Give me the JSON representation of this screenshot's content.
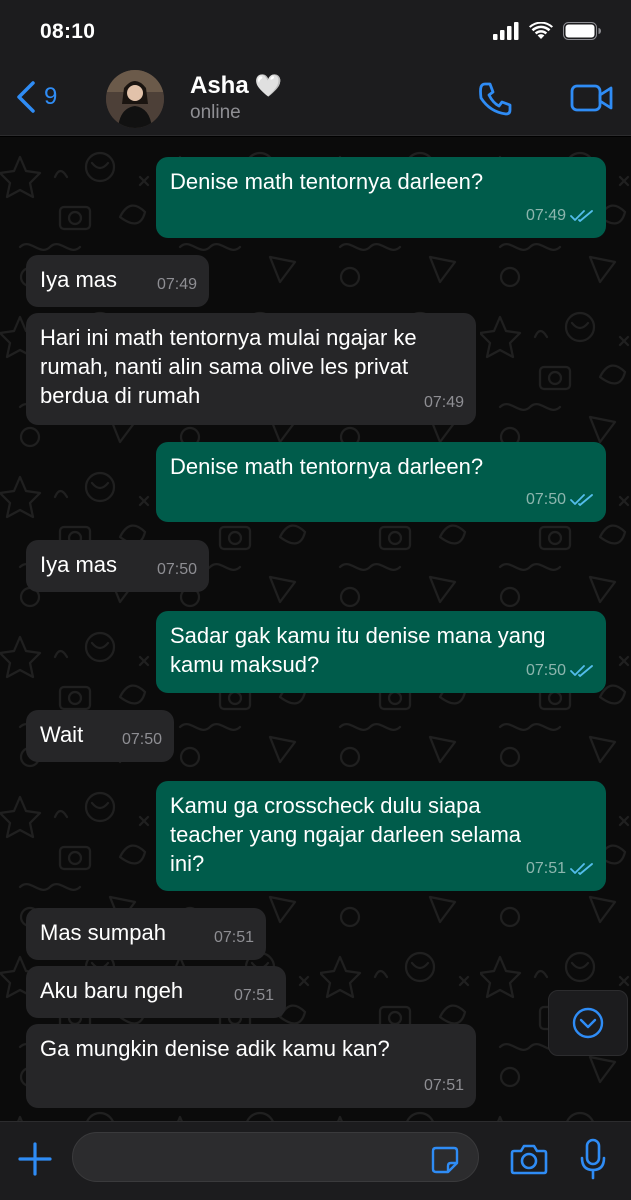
{
  "status_bar": {
    "time": "08:10"
  },
  "header": {
    "back_count": "9",
    "contact_name": "Asha",
    "contact_emoji": "🤍",
    "contact_status": "online",
    "icons": [
      "chevron-left-icon",
      "phone-icon",
      "video-camera-icon"
    ]
  },
  "messages": [
    {
      "direction": "out",
      "text": "Denise math tentornya darleen?",
      "time": "07:49",
      "read": true
    },
    {
      "direction": "in",
      "text": "Iya mas",
      "time": "07:49"
    },
    {
      "direction": "in",
      "text": "Hari ini math tentornya mulai ngajar ke\nrumah, nanti alin sama olive les privat\nberdua di rumah",
      "time": "07:49"
    },
    {
      "direction": "out",
      "text": "Denise math tentornya darleen?",
      "time": "07:50",
      "read": true
    },
    {
      "direction": "in",
      "text": "Iya mas",
      "time": "07:50"
    },
    {
      "direction": "out",
      "text": "Sadar gak kamu itu denise mana yang\nkamu maksud?",
      "time": "07:50",
      "read": true
    },
    {
      "direction": "in",
      "text": "Wait",
      "time": "07:50"
    },
    {
      "direction": "out",
      "text": "Kamu ga crosscheck dulu siapa\nteacher yang ngajar darleen selama\nini?",
      "time": "07:51",
      "read": true
    },
    {
      "direction": "in",
      "text": "Mas sumpah",
      "time": "07:51"
    },
    {
      "direction": "in",
      "text": "Aku baru ngeh",
      "time": "07:51"
    },
    {
      "direction": "in",
      "text": "Ga mungkin denise adik kamu kan?",
      "time": "07:51"
    }
  ],
  "input": {
    "value": "",
    "placeholder": ""
  },
  "colors": {
    "accent": "#2f8cf5",
    "outgoing_bubble": "#005c4b",
    "incoming_bubble": "#262628",
    "read_ticks": "#53bdeb",
    "bar_background": "#1c1c1e"
  }
}
